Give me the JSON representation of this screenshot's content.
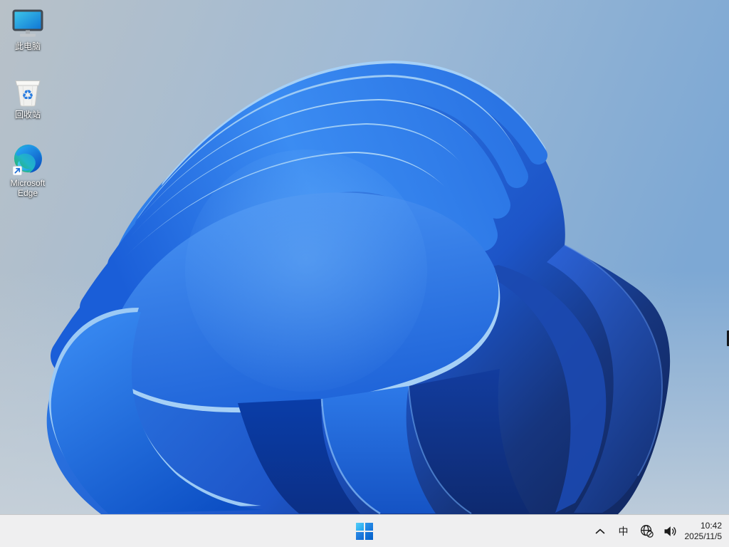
{
  "wallpaper": {
    "description": "Windows 11 blue bloom wallpaper on light blue-gray sky",
    "palette": {
      "sky_top_left": "#b8c1c8",
      "sky_mid": "#9fbad5",
      "sky_top_right": "#7da8d4",
      "sky_bottom": "#ccd4db",
      "bloom_bright": "#3b8cf2",
      "bloom_mid": "#1d55c8",
      "bloom_navy": "#122a66",
      "bloom_edge_light": "#a6d0f6"
    }
  },
  "desktop": {
    "icons": [
      {
        "label": "此电脑",
        "icon": "monitor-icon"
      },
      {
        "label": "回收站",
        "icon": "recycle-bin-icon",
        "glyph": "♻"
      },
      {
        "label": "Microsoft Edge",
        "icon": "edge-icon"
      }
    ]
  },
  "taskbar": {
    "start_icon": "windows-logo-icon",
    "tray": {
      "hidden_icons_icon": "chevron-up-icon",
      "input_method_label": "中",
      "network_icon": "globe-no-internet-icon",
      "volume_icon": "speaker-icon",
      "clock": {
        "time": "10:42",
        "date": "2025/11/5"
      }
    }
  },
  "theme": {
    "taskbar-bg": "#efeff0",
    "taskbar-border": "#c8c8c8",
    "tray-icon-color": "#1b1b1b",
    "icon-label-color": "#ffffff",
    "accent-blue": "#0d6fd8"
  }
}
